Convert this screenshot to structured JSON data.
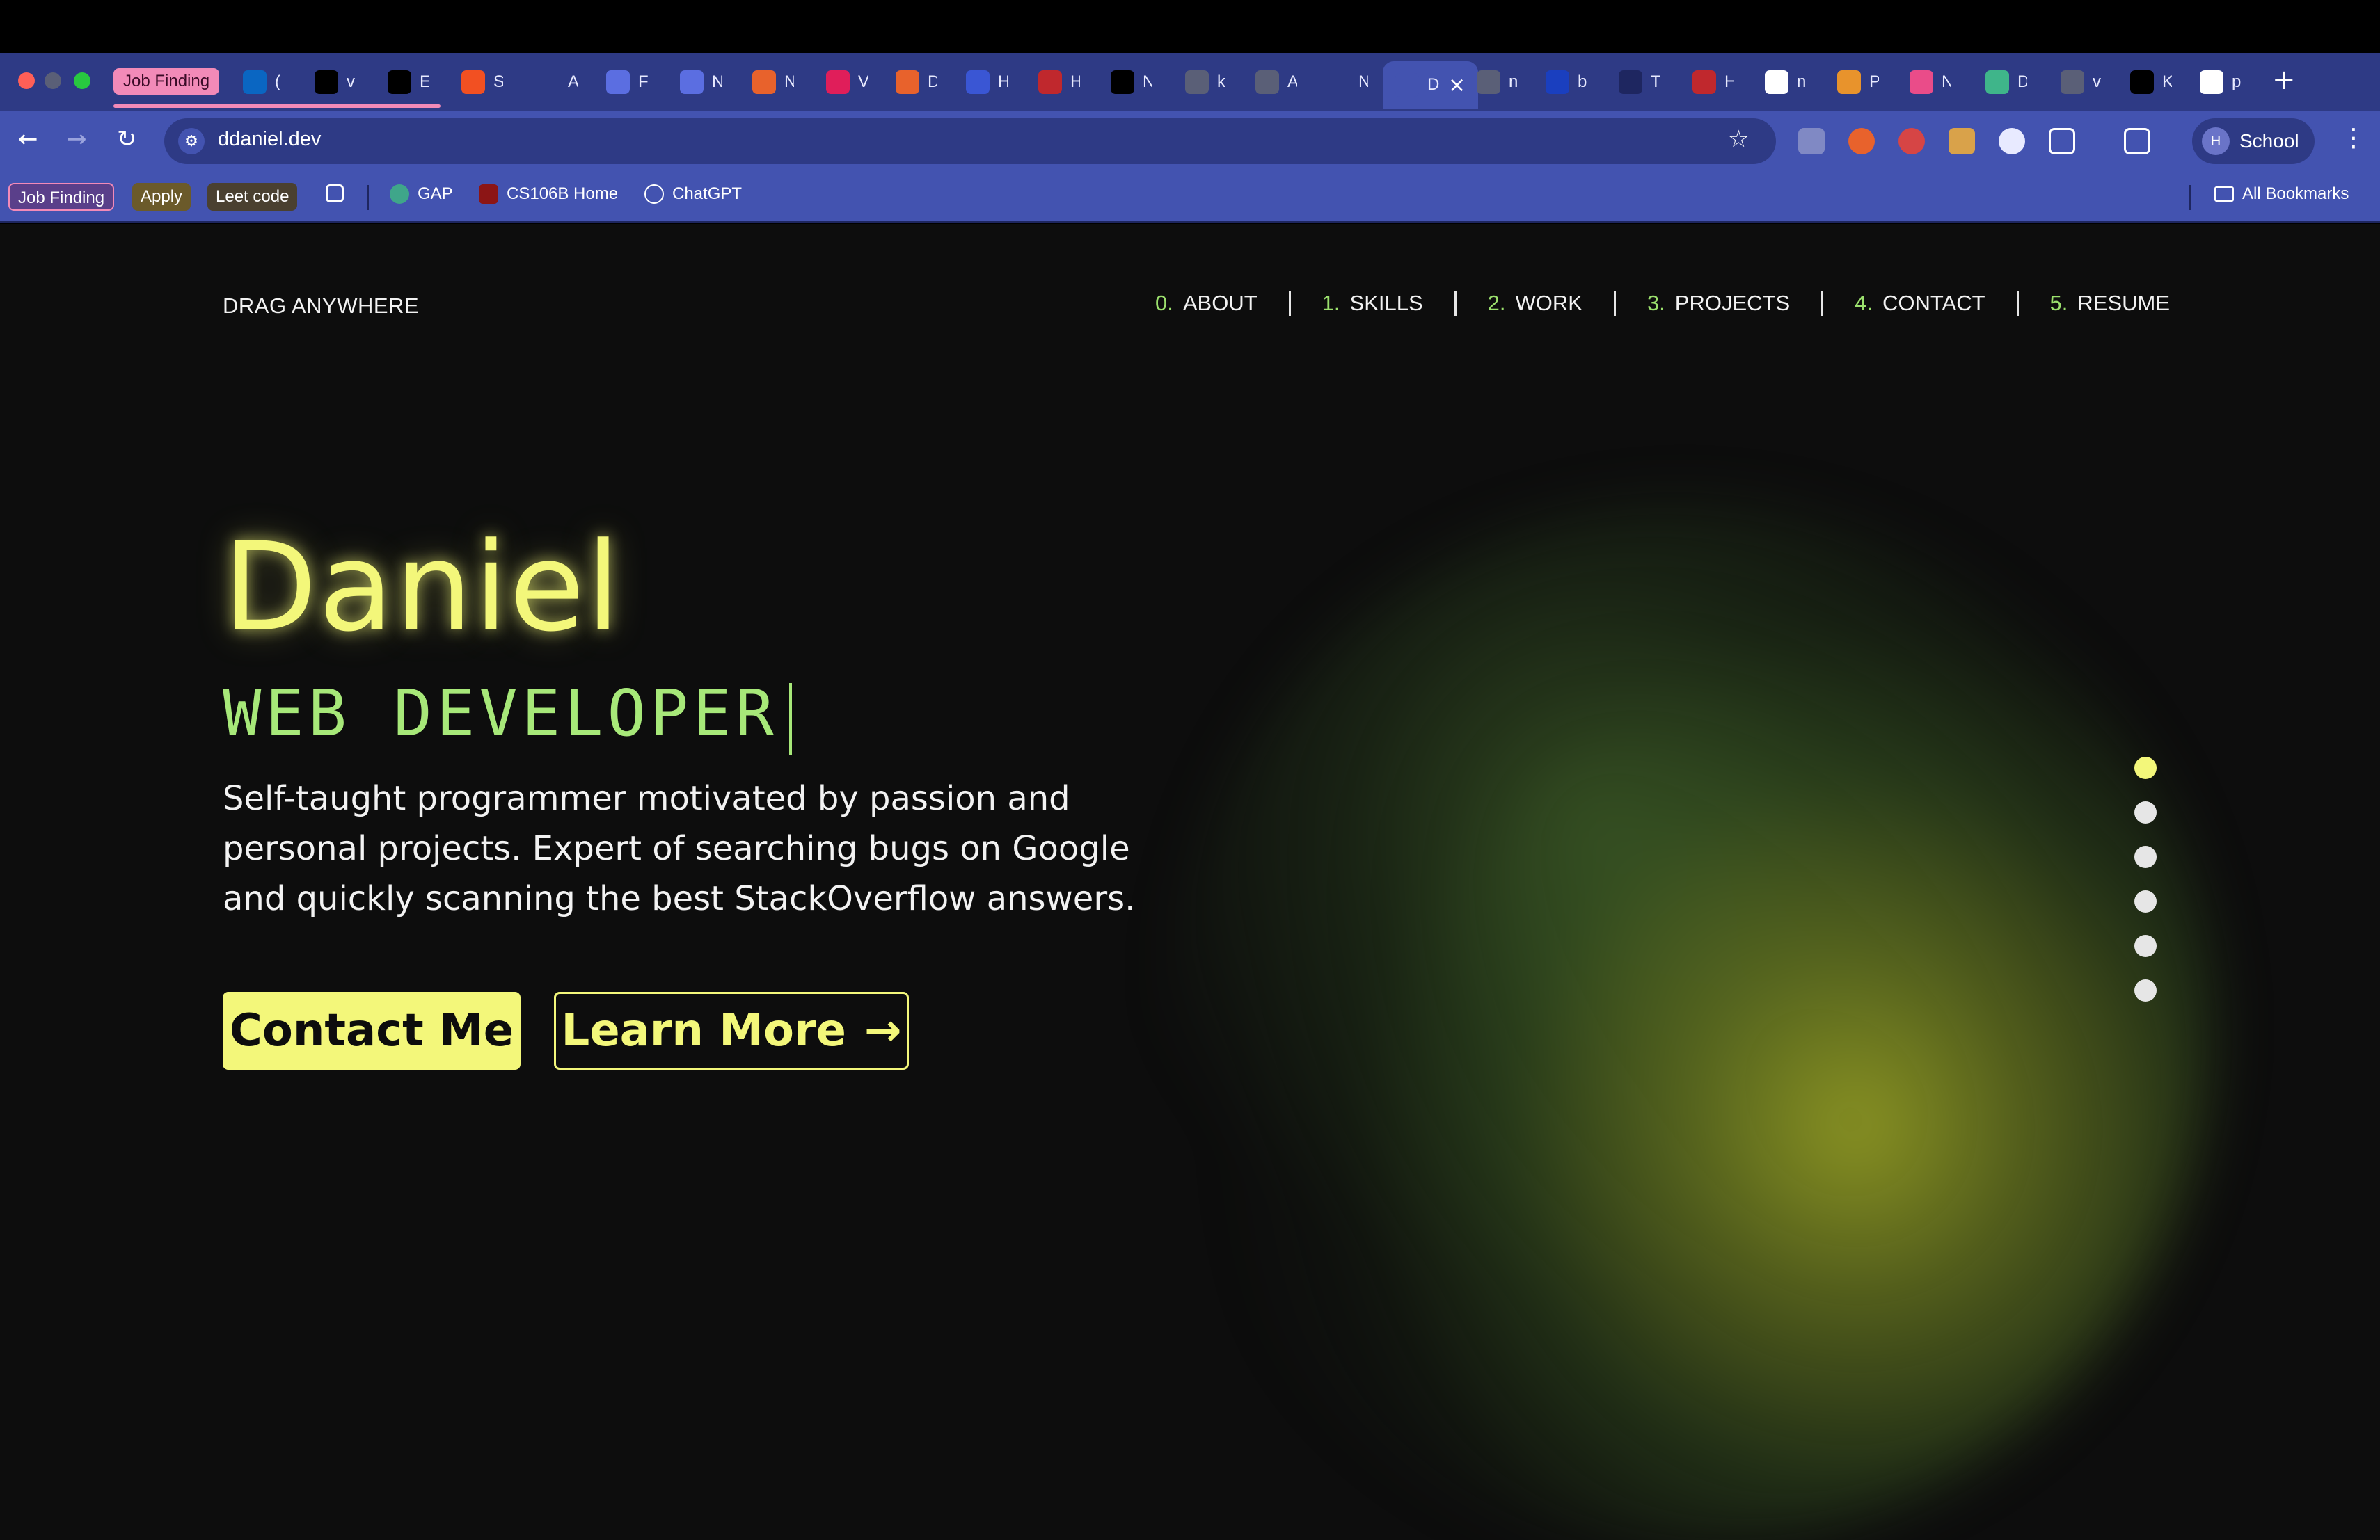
{
  "browser": {
    "tab_group_label": "Job Finding",
    "tabs": [
      {
        "icon": "linkedin-icon",
        "text": "(",
        "color": "#0a66c2"
      },
      {
        "icon": "github-icon",
        "text": "v",
        "color": "#000000"
      },
      {
        "icon": "tiktok-icon",
        "text": "E",
        "color": "#000000"
      },
      {
        "icon": "microsoft-icon",
        "text": "S",
        "color": "#f25022"
      },
      {
        "icon": "openai-icon",
        "text": "A",
        "color": "#2e3a85"
      },
      {
        "icon": "document-icon",
        "text": "F",
        "color": "#5b6ee1"
      },
      {
        "icon": "document-icon",
        "text": "N",
        "color": "#5b6ee1"
      },
      {
        "icon": "nodes-icon",
        "text": "N",
        "color": "#e8622c"
      },
      {
        "icon": "slack-icon",
        "text": "V",
        "color": "#e01e5a"
      },
      {
        "icon": "nodes-icon",
        "text": "D",
        "color": "#e8622c"
      },
      {
        "icon": "globe-blue-icon",
        "text": "H",
        "color": "#3a56d4"
      },
      {
        "icon": "red-logo-icon",
        "text": "H",
        "color": "#c0282d"
      },
      {
        "icon": "triangle-icon",
        "text": "N",
        "color": "#000000"
      },
      {
        "icon": "globe-icon",
        "text": "k",
        "color": "#5a5f77"
      },
      {
        "icon": "a-icon",
        "text": "A",
        "color": "#5a5f77"
      },
      {
        "icon": "mh-icon",
        "text": "N",
        "color": "#2e3a85"
      },
      {
        "icon": "d-icon",
        "text": "D",
        "color": "#4353b0"
      },
      {
        "icon": "globe-icon",
        "text": "n",
        "color": "#5a5f77"
      },
      {
        "icon": "shield-blue-icon",
        "text": "b",
        "color": "#1a3fbf"
      },
      {
        "icon": "ttt-icon",
        "text": "T",
        "color": "#1e2660"
      },
      {
        "icon": "red-logo-icon",
        "text": "H",
        "color": "#c0282d"
      },
      {
        "icon": "google-icon",
        "text": "n",
        "color": "#ffffff"
      },
      {
        "icon": "gear-orange-icon",
        "text": "P",
        "color": "#e8932c"
      },
      {
        "icon": "dribbble-icon",
        "text": "N",
        "color": "#ea4c89"
      },
      {
        "icon": "diamond-icon",
        "text": "D",
        "color": "#3fb58a"
      },
      {
        "icon": "globe-icon",
        "text": "v",
        "color": "#5a5f77"
      },
      {
        "icon": "github-icon",
        "text": "K",
        "color": "#000000"
      },
      {
        "icon": "google-icon",
        "text": "p",
        "color": "#ffffff"
      }
    ],
    "active_tab_index": 16,
    "url": "ddaniel.dev",
    "profile_initial": "H",
    "profile_name": "School",
    "bookmarks": {
      "chips": [
        "Job Finding",
        "Apply",
        "Leet code"
      ],
      "items": [
        "GAP",
        "CS106B Home",
        "ChatGPT"
      ],
      "all_bookmarks": "All Bookmarks"
    }
  },
  "site": {
    "drag_label": "DRAG ANYWHERE",
    "nav": [
      {
        "num": "0.",
        "label": "ABOUT"
      },
      {
        "num": "1.",
        "label": "SKILLS"
      },
      {
        "num": "2.",
        "label": "WORK"
      },
      {
        "num": "3.",
        "label": "PROJECTS"
      },
      {
        "num": "4.",
        "label": "CONTACT"
      },
      {
        "num": "5.",
        "label": "RESUME"
      }
    ],
    "name": "Daniel",
    "role": "WEB DEVELOPER",
    "description": "Self-taught programmer motivated by passion and personal projects. Expert of searching bugs on Google and quickly scanning the best StackOverflow answers.",
    "contact_button": "Contact Me",
    "learn_button": "Learn More",
    "learn_arrow": "→",
    "section_dots": 6,
    "active_dot": 0,
    "colors": {
      "accent_yellow": "#f3f77a",
      "accent_green": "#a7e879",
      "background": "#0d0d0d",
      "chrome_blue": "#4353b0"
    }
  }
}
